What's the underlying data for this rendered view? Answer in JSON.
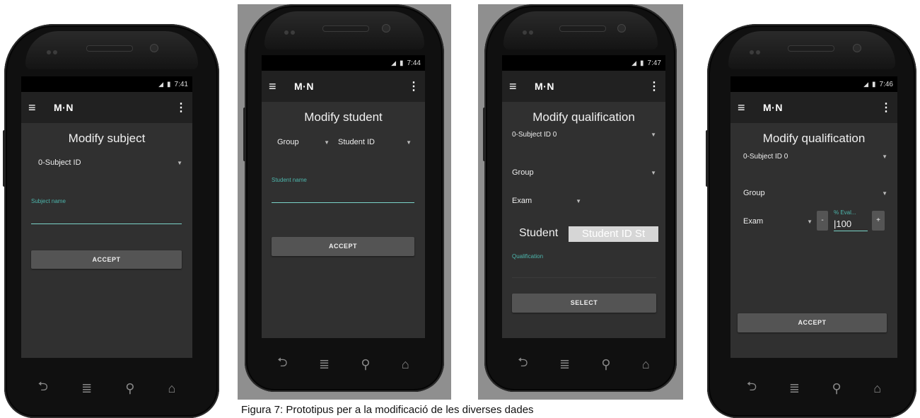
{
  "app_title": "M·N",
  "phones": [
    {
      "time": "7:41",
      "heading": "Modify subject",
      "subject_spinner": "0-Subject ID",
      "subject_name_label": "Subject name",
      "accept_label": "ACCEPT"
    },
    {
      "time": "7:44",
      "heading": "Modify student",
      "group_spinner": "Group",
      "student_id_spinner": "Student ID",
      "student_name_label": "Student name",
      "accept_label": "ACCEPT"
    },
    {
      "time": "7:47",
      "heading": "Modify qualification",
      "subject_spinner": "0-Subject ID 0",
      "group_spinner": "Group",
      "exam_spinner": "Exam",
      "student_label": "Student",
      "student_id_field": "Student ID St",
      "qualification_label": "Qualification",
      "select_label": "SELECT"
    },
    {
      "time": "7:46",
      "heading": "Modify qualification",
      "subject_spinner": "0-Subject ID 0",
      "group_spinner": "Group",
      "exam_spinner": "Exam",
      "minus_label": "-",
      "eval_label": "% Eval...",
      "eval_value": "100",
      "plus_label": "+",
      "accept_label": "ACCEPT"
    }
  ],
  "caption": "Figura 7: Prototipus per a la modificació de les diverses dades",
  "colors": {
    "accent": "#4db6ac",
    "screen_bg": "#303030",
    "appbar_bg": "#212121",
    "button_bg": "#545454"
  },
  "icons": {
    "menu": "≡",
    "more": "⋮",
    "back": "⮌",
    "home_menu": "≣",
    "search": "⚲",
    "home": "⌂",
    "dropdown": "▼"
  }
}
